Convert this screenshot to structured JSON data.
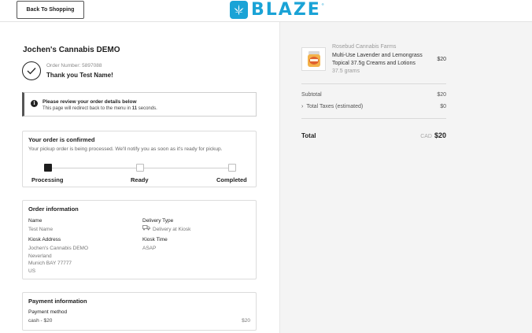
{
  "header": {
    "back_label": "Back To Shopping",
    "logo_text": "BLAZE",
    "logo_tm": "®",
    "brand_color": "#1aa3d6"
  },
  "confirmation": {
    "store_name": "Jochen's Cannabis DEMO",
    "order_number": "Order Number: 5897088",
    "thanks": "Thank you Test Name!"
  },
  "notice": {
    "icon": "info-icon",
    "title": "Please review your order details below",
    "text_prefix": "This page will redirect back to the menu in ",
    "seconds": "11",
    "text_suffix": " seconds."
  },
  "status": {
    "title": "Your order is confirmed",
    "subtitle": "Your pickup order is being processed. We'll notify you as soon as it's ready for pickup.",
    "steps": [
      {
        "label": "Processing",
        "active": true
      },
      {
        "label": "Ready",
        "active": false
      },
      {
        "label": "Completed",
        "active": false
      }
    ]
  },
  "order_info": {
    "title": "Order information",
    "name_label": "Name",
    "name_value": "Test Name",
    "delivery_label": "Delivery Type",
    "delivery_value": "Delivery at Kiosk",
    "kiosk_address_label": "Kiosk Address",
    "kiosk_address_lines": [
      "Jochen's Cannabis DEMO",
      "Neverland",
      "Munich BAY 77777",
      "US"
    ],
    "kiosk_time_label": "Kiosk Time",
    "kiosk_time_value": "ASAP"
  },
  "payment": {
    "title": "Payment information",
    "method_label": "Payment method",
    "method_value": "cash - $20",
    "amount": "$20"
  },
  "cart": {
    "item": {
      "brand": "Rosebud Cannabis Farms",
      "name": "Multi-Use Lavender and Lemongrass Topical 37.5g Creams and Lotions",
      "size": "37.5 grams",
      "price": "$20"
    },
    "subtotal_label": "Subtotal",
    "subtotal_value": "$20",
    "taxes_label": "Total Taxes (estimated)",
    "taxes_value": "$0",
    "total_label": "Total",
    "total_currency": "CAD",
    "total_value": "$20"
  }
}
